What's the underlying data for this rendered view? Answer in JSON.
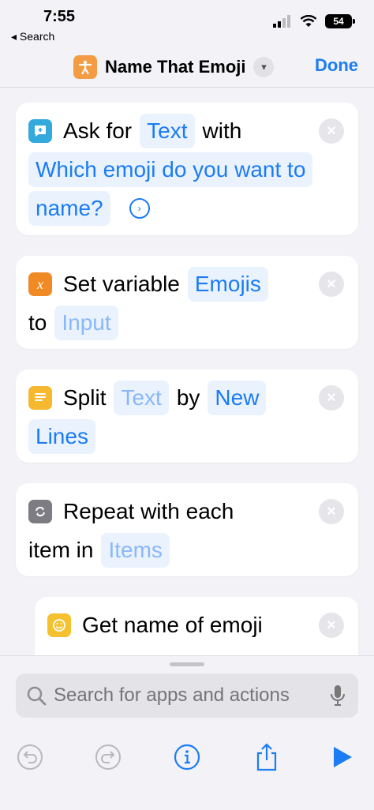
{
  "status": {
    "time": "7:55",
    "back_app": "◂ Search",
    "battery": "54"
  },
  "nav": {
    "title": "Name That Emoji",
    "done": "Done"
  },
  "cards": [
    {
      "icon": "ask-for-input-icon",
      "color": "#34aadc",
      "line1": {
        "verb": "Ask for",
        "token": "Text",
        "word": "with"
      },
      "line2": "Which emoji do you want to",
      "line3": "name?"
    },
    {
      "icon": "variable-icon",
      "color": "#f08a24",
      "line1": {
        "verb": "Set variable",
        "token": "Emojis"
      },
      "line2": {
        "word": "to",
        "token": "Input"
      }
    },
    {
      "icon": "text-split-icon",
      "color": "#f5b82e",
      "line1": {
        "verb": "Split",
        "token": "Text",
        "word": "by",
        "token2": "New"
      },
      "line2": "Lines"
    },
    {
      "icon": "repeat-icon",
      "color": "#7c7c82",
      "line1": {
        "verb": "Repeat with each"
      },
      "line2": {
        "word": "item in",
        "token": "Items"
      }
    },
    {
      "icon": "emoji-icon",
      "color": "#f5c12e",
      "line1": {
        "verb": "Get name of emoji"
      }
    }
  ],
  "search": {
    "placeholder": "Search for apps and actions"
  }
}
